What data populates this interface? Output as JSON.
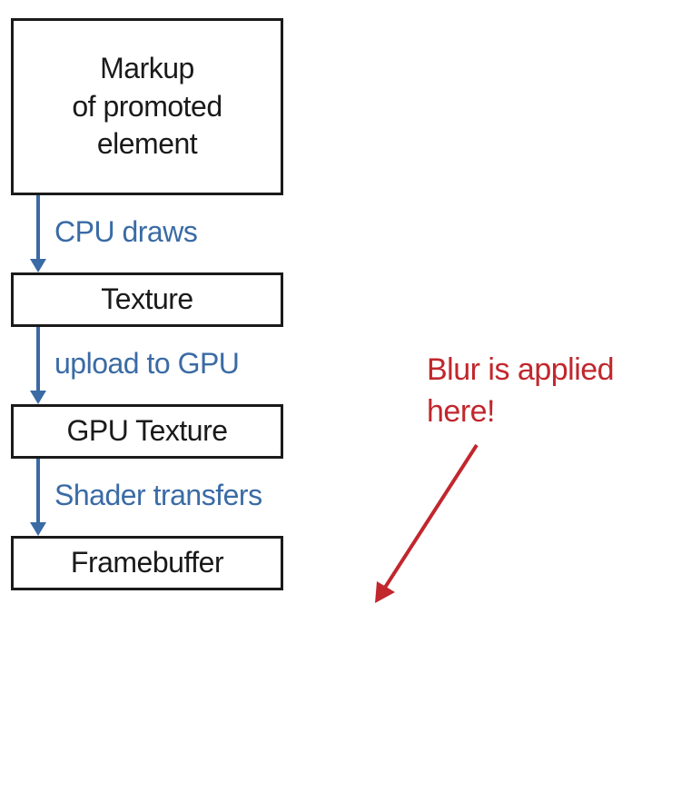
{
  "nodes": {
    "markup": {
      "line1": "Markup",
      "line2": "of promoted",
      "line3": "element"
    },
    "texture": "Texture",
    "gpu_texture": "GPU Texture",
    "framebuffer": "Framebuffer"
  },
  "connectors": {
    "cpu_draws": "CPU draws",
    "upload_to_gpu": "upload to GPU",
    "shader_transfers": "Shader transfers"
  },
  "annotation": {
    "line1": "Blur is applied",
    "line2": "here!"
  },
  "colors": {
    "node_border": "#1a1a1a",
    "node_text": "#1a1a1a",
    "connector": "#3a6ba5",
    "annotation": "#c1272d"
  }
}
